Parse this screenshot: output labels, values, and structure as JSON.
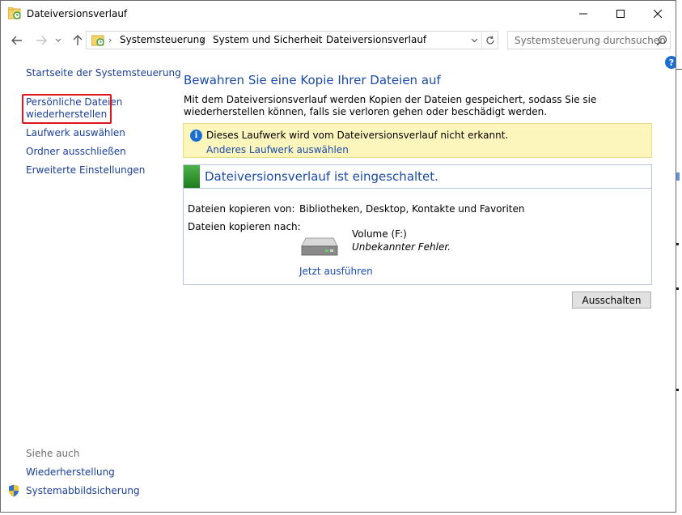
{
  "window": {
    "title": "Dateiversionsverlauf"
  },
  "addressbar": {
    "crumbs": [
      "Systemsteuerung",
      "System und Sicherheit",
      "Dateiversionsverlauf"
    ],
    "search_placeholder": "Systemsteuerung durchsuchen"
  },
  "help_label": "?",
  "sidebar": {
    "home": "Startseite der Systemsteuerung",
    "items": [
      {
        "label_line1": "Persönliche Dateien",
        "label_line2": "wiederherstellen"
      },
      {
        "label": "Laufwerk auswählen"
      },
      {
        "label": "Ordner ausschließen"
      },
      {
        "label": "Erweiterte Einstellungen"
      }
    ],
    "see_also_heading": "Siehe auch",
    "see_also": [
      {
        "label": "Wiederherstellung"
      },
      {
        "label": "Systemabbildsicherung"
      }
    ]
  },
  "main": {
    "heading": "Bewahren Sie eine Kopie Ihrer Dateien auf",
    "description": "Mit dem Dateiversionsverlauf werden Kopien der Dateien gespeichert, sodass Sie sie wiederherstellen können, falls sie verloren gehen oder beschädigt werden.",
    "info": {
      "text": "Dieses Laufwerk wird vom Dateiversionsverlauf nicht erkannt.",
      "link": "Anderes Laufwerk auswählen"
    },
    "status": {
      "title": "Dateiversionsverlauf ist eingeschaltet.",
      "copy_from_label": "Dateien kopieren von:",
      "copy_from_value": "Bibliotheken, Desktop, Kontakte und Favoriten",
      "copy_to_label": "Dateien kopieren nach:",
      "volume_name": "Volume (F:)",
      "volume_error": "Unbekannter Fehler.",
      "run_link": "Jetzt ausführen"
    },
    "off_button": "Ausschalten"
  },
  "colors": {
    "link": "#1a3e97",
    "heading": "#1b4aa6",
    "info_bg": "#fcf6bd",
    "highlight": "#e0151b",
    "status_green": "#2a8a27"
  }
}
